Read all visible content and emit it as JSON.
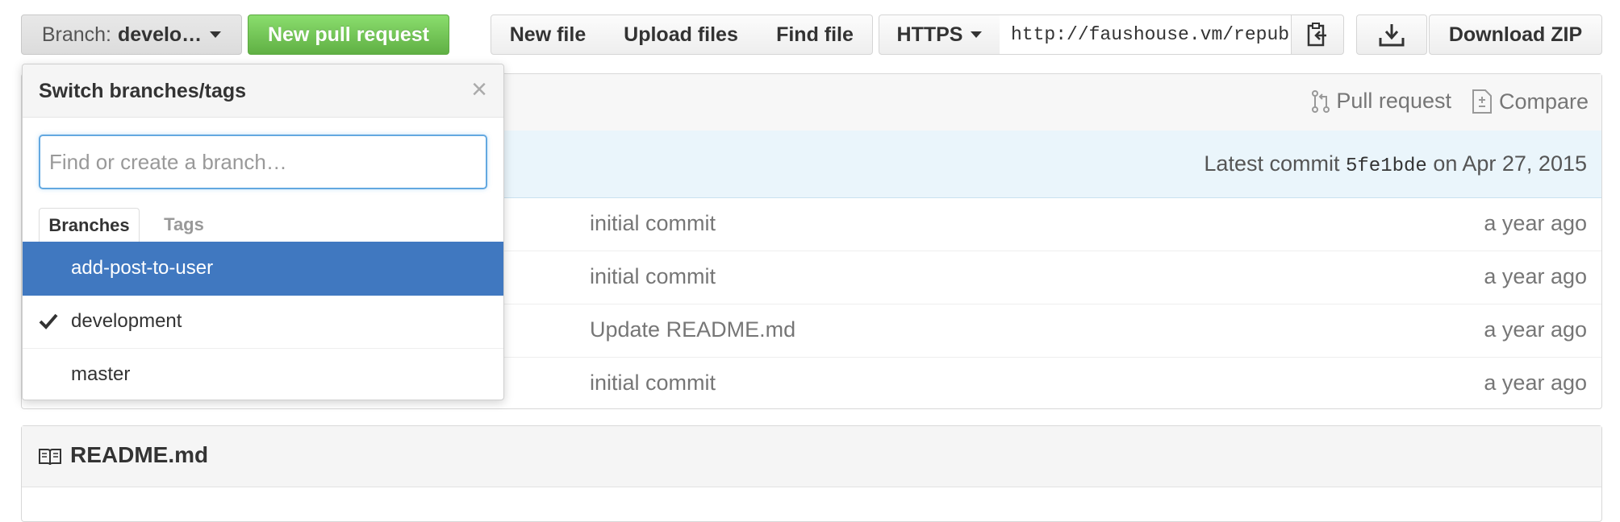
{
  "toolbar": {
    "branch_prefix": "Branch:",
    "branch_name": "develo…",
    "new_pull_request": "New pull request",
    "new_file": "New file",
    "upload_files": "Upload files",
    "find_file": "Find file",
    "clone_protocol": "HTTPS",
    "clone_url": "http://faushouse.vm/repub",
    "download_zip": "Download ZIP"
  },
  "repo": {
    "pull_request_link": "Pull request",
    "compare_link": "Compare",
    "latest_commit_prefix": "Latest commit",
    "latest_commit_sha": "5fe1bde",
    "latest_commit_date": "on Apr 27, 2015",
    "files": [
      {
        "message": "initial commit",
        "age": "a year ago"
      },
      {
        "message": "initial commit",
        "age": "a year ago"
      },
      {
        "message": "Update README.md",
        "age": "a year ago"
      },
      {
        "message": "initial commit",
        "age": "a year ago"
      }
    ]
  },
  "readme": {
    "title": "README.md"
  },
  "branch_dropdown": {
    "title": "Switch branches/tags",
    "close": "×",
    "filter_placeholder": "Find or create a branch…",
    "tabs": [
      "Branches",
      "Tags"
    ],
    "items": [
      {
        "label": "add-post-to-user",
        "highlighted": true,
        "checked": false
      },
      {
        "label": "development",
        "highlighted": false,
        "checked": true
      },
      {
        "label": "master",
        "highlighted": false,
        "checked": false
      }
    ]
  },
  "colors": {
    "primary_green": "#6cc644",
    "highlight_blue": "#4078c0",
    "commit_bar": "#eaf5fb"
  }
}
